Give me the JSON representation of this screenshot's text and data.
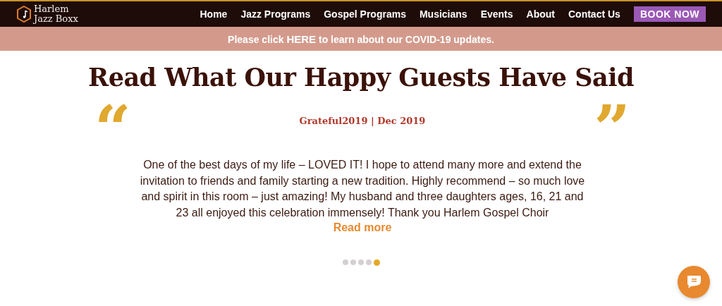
{
  "header": {
    "logo": {
      "line_1": "Harlem",
      "line_2": "Jazz Boxx"
    },
    "nav": [
      {
        "label": "Home"
      },
      {
        "label": "Jazz Programs"
      },
      {
        "label": "Gospel Programs"
      },
      {
        "label": "Musicians"
      },
      {
        "label": "Events"
      },
      {
        "label": "About"
      },
      {
        "label": "Contact Us"
      }
    ],
    "cta": "BOOK NOW"
  },
  "banner": {
    "text": "Please click **HERE** to learn about our COVID-19 updates."
  },
  "heading": "Read What Our Happy Guests Have Said",
  "testimonial": {
    "open_quote": "“",
    "close_quote": "”",
    "author": "Grateful2019 | Dec 2019",
    "text": "One of the best days of my life – LOVED IT! I hope to attend many more and extend the invitation to friends and family starting a new tradition. Highly recommend – so much love and spirit in this room – just amazing! My husband and three daughters ages, 16, 21 and 23 all enjoyed this celebration immensely! Thank you Harlem Gospel Choir",
    "read_more": "Read more"
  },
  "pager": [
    {
      "selected": false
    },
    {
      "selected": false
    },
    {
      "selected": false
    },
    {
      "selected": false
    },
    {
      "selected": true
    }
  ]
}
